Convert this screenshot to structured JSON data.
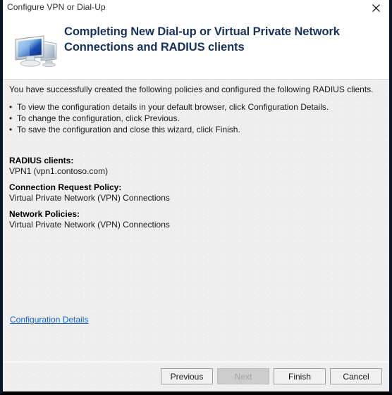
{
  "window": {
    "title": "Configure VPN or Dial-Up",
    "close_icon": "close-icon"
  },
  "header": {
    "icon": "computer-monitors-icon",
    "title": "Completing New Dial-up or Virtual Private Network Connections and RADIUS clients",
    "title_color": "#16325c"
  },
  "main": {
    "intro": "You have successfully created the following policies and configured the following RADIUS clients.",
    "bullets": [
      "To view the configuration details in your default browser, click Configuration Details.",
      "To change the configuration, click Previous.",
      "To save the configuration and close this wizard, click Finish."
    ],
    "bullet_glyph": "•",
    "summary": [
      {
        "label": "RADIUS clients:",
        "value": "VPN1 (vpn1.contoso.com)"
      },
      {
        "label": "Connection Request Policy:",
        "value": "Virtual Private Network (VPN) Connections"
      },
      {
        "label": "Network Policies:",
        "value": "Virtual Private Network (VPN) Connections"
      }
    ],
    "details_link": "Configuration Details",
    "link_color": "#1263cf"
  },
  "footer": {
    "buttons": [
      {
        "label": "Previous",
        "disabled": false
      },
      {
        "label": "Next",
        "disabled": true
      },
      {
        "label": "Finish",
        "disabled": false
      },
      {
        "label": "Cancel",
        "disabled": false
      }
    ]
  }
}
